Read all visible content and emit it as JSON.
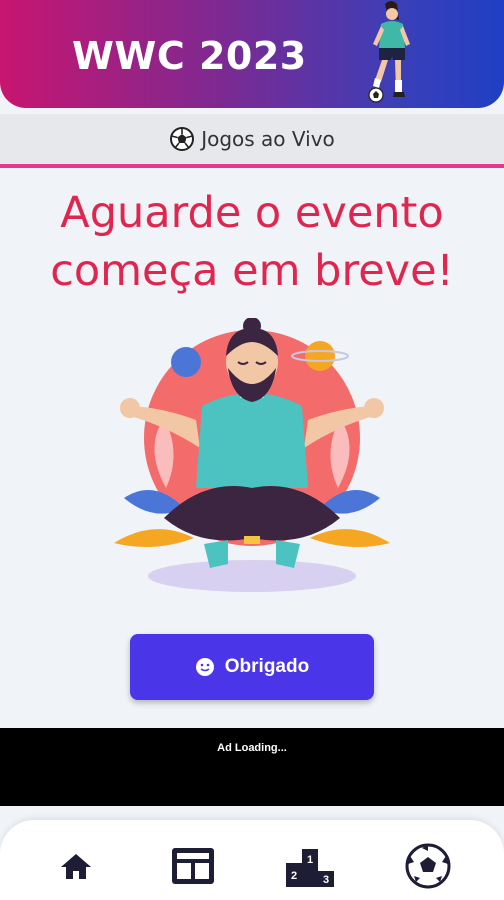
{
  "header": {
    "title": "WWC 2023",
    "illustration": "soccer-player-icon",
    "gradient": [
      "#c8156f",
      "#7b2a93",
      "#1f3fc4"
    ]
  },
  "live_bar": {
    "icon": "soccer-ball-icon",
    "label": "Jogos ao Vivo",
    "accent": "#e8358f"
  },
  "headline": {
    "line1": "Aguarde o evento",
    "line2": "começa em breve!",
    "color": "#e0264f"
  },
  "illustration": "meditating-man-icon",
  "action": {
    "icon": "smile-icon",
    "label": "Obrigado",
    "color": "#4a35e8"
  },
  "ad": {
    "text": "Ad Loading..."
  },
  "bottom_nav": {
    "items": [
      {
        "icon": "home-icon"
      },
      {
        "icon": "table-grid-icon"
      },
      {
        "icon": "podium-icon"
      },
      {
        "icon": "soccer-ball-icon"
      }
    ],
    "podium_numbers": [
      "1",
      "2",
      "3"
    ]
  }
}
